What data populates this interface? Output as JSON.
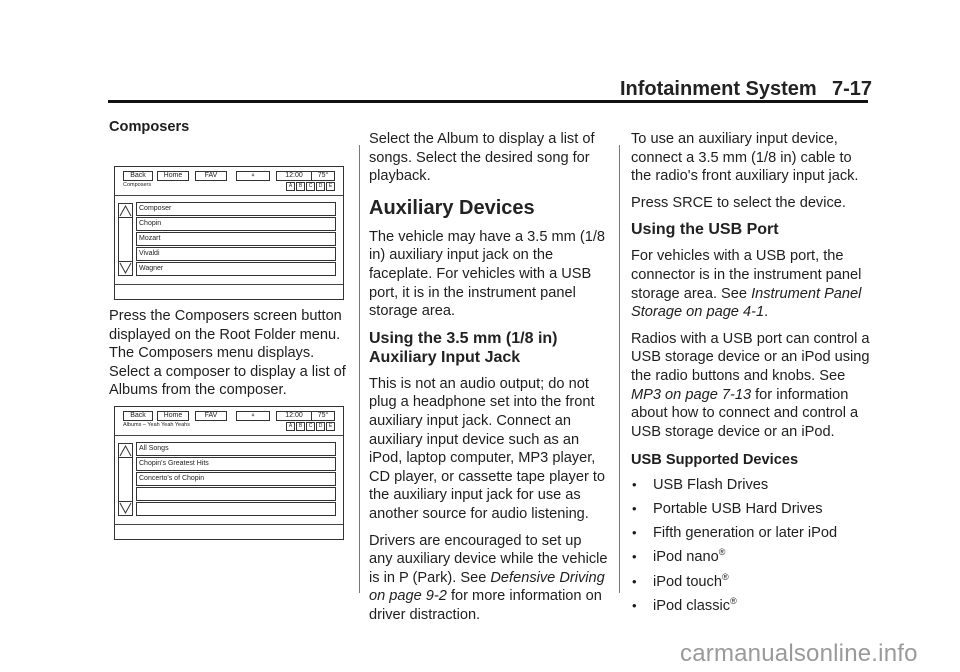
{
  "header": {
    "section_title": "Infotainment System",
    "page_number": "7-17"
  },
  "column1": {
    "heading": "Composers",
    "screen1": {
      "buttons": [
        "Back",
        "Home",
        "FAV",
        "⚘",
        "12:00",
        "75°"
      ],
      "menu_title": "Composers",
      "presets": [
        "A",
        "B",
        "C",
        "D",
        "E"
      ],
      "rows": [
        "Composer",
        "Chopin",
        "Mozart",
        "Vivaldi",
        "Wagner"
      ]
    },
    "paragraph": "Press the Composers screen button displayed on the Root Folder menu. The Composers menu displays. Select a composer to display a list of Albums from the composer.",
    "screen2": {
      "buttons": [
        "Back",
        "Home",
        "FAV",
        "⚘",
        "12:00",
        "75°"
      ],
      "menu_title": "Albums – Yeah Yeah Yeahs",
      "presets": [
        "A",
        "B",
        "C",
        "D",
        "E"
      ],
      "rows": [
        "All Songs",
        "Chopin's Greatest Hits",
        "Concerto's of Chopin",
        "",
        ""
      ]
    }
  },
  "column2": {
    "intro": "Select the Album to display a list of songs. Select the desired song for playback.",
    "heading_aux": "Auxiliary Devices",
    "aux_para": "The vehicle may have a 3.5 mm (1/8 in) auxiliary input jack on the faceplate. For vehicles with a USB port, it is in the instrument panel storage area.",
    "heading_jack": "Using the 3.5 mm (1/8 in) Auxiliary Input Jack",
    "jack_para": "This is not an audio output; do not plug a headphone set into the front auxiliary input jack. Connect an auxiliary input device such as an iPod, laptop computer, MP3 player, CD player, or cassette tape player to the auxiliary input jack for use as another source for audio listening.",
    "drivers_para_start": "Drivers are encouraged to set up any auxiliary device while the vehicle is in P (Park). See ",
    "drivers_link": "Defensive Driving on page 9-2",
    "drivers_para_end": " for more information on driver distraction."
  },
  "column3": {
    "connect_para": "To use an auxiliary input device, connect a 3.5 mm (1/8 in) cable to the radio's front auxiliary input jack.",
    "srce_para": "Press SRCE to select the device.",
    "heading_usb": "Using the USB Port",
    "usb_para_start": "For vehicles with a USB port, the connector is in the instrument panel storage area. See ",
    "usb_link": "Instrument Panel Storage on page 4-1",
    "usb_para_end": ".",
    "radios_para_start": "Radios with a USB port can control a USB storage device or an iPod using the radio buttons and knobs. See ",
    "radios_link": "MP3 on page 7-13",
    "radios_para_end": " for information about how to connect and control a USB storage device or an iPod.",
    "supported_heading": "USB Supported Devices",
    "supported_devices": [
      {
        "label": "USB Flash Drives",
        "reg": ""
      },
      {
        "label": "Portable USB Hard Drives",
        "reg": ""
      },
      {
        "label": "Fifth generation or later iPod",
        "reg": ""
      },
      {
        "label": "iPod nano",
        "reg": "®"
      },
      {
        "label": "iPod touch",
        "reg": "®"
      },
      {
        "label": "iPod classic",
        "reg": "®"
      }
    ]
  },
  "watermark": "carmanualsonline.info"
}
